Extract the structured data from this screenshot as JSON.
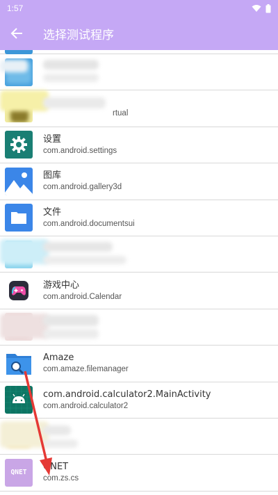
{
  "status_bar": {
    "time": "1:57"
  },
  "app_bar": {
    "title": "选择测试程序"
  },
  "apps": [
    {
      "name": "",
      "package": ""
    },
    {
      "name": "",
      "package": ""
    },
    {
      "name": "",
      "package": "rtual"
    },
    {
      "name": "设置",
      "package": "com.android.settings",
      "icon": "gear-icon",
      "color": "#1a7f74"
    },
    {
      "name": "图库",
      "package": "com.android.gallery3d",
      "icon": "gallery-icon",
      "color": "#3b86e8"
    },
    {
      "name": "文件",
      "package": "com.android.documentsui",
      "icon": "folder-icon",
      "color": "#3b86e8"
    },
    {
      "name": "",
      "package": ""
    },
    {
      "name": "游戏中心",
      "package": "com.android.Calendar",
      "icon": "gamepad-icon",
      "color": "#2b2c3a"
    },
    {
      "name": "",
      "package": ""
    },
    {
      "name": "Amaze",
      "package": "com.amaze.filemanager",
      "icon": "folder-search-icon",
      "color": "#2f7fd6"
    },
    {
      "name": "com.android.calculator2.MainActivity",
      "package": "com.android.calculator2",
      "icon": "android-icon",
      "color": "#0d7563"
    },
    {
      "name": "",
      "package": ""
    },
    {
      "name": "QNET",
      "package": "com.zs.cs",
      "icon": "qnet-icon",
      "color": "#c9a6e6"
    }
  ],
  "qnet_logo_text": "QNET",
  "colors": {
    "accent": "#c5a8f5",
    "annotation": "#e53935"
  }
}
